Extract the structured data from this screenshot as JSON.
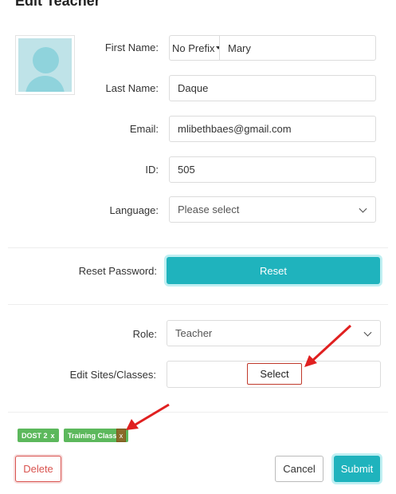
{
  "modal": {
    "title": "Edit Teacher"
  },
  "form": {
    "first_name": {
      "label": "First Name:",
      "prefix": "No Prefix",
      "value": "Mary"
    },
    "last_name": {
      "label": "Last Name:",
      "value": "Daque"
    },
    "email": {
      "label": "Email:",
      "value": "mlibethbaes@gmail.com"
    },
    "id": {
      "label": "ID:",
      "value": "505"
    },
    "language": {
      "label": "Language:",
      "placeholder": "Please select"
    },
    "reset_password": {
      "label": "Reset Password:",
      "button": "Reset"
    },
    "role": {
      "label": "Role:",
      "value": "Teacher"
    },
    "sites": {
      "label": "Edit Sites/Classes:",
      "button": "Select"
    }
  },
  "tags": [
    {
      "label": "DOST 2",
      "remove": "x"
    },
    {
      "label": "Training Class",
      "remove": "x"
    }
  ],
  "footer": {
    "delete": "Delete",
    "cancel": "Cancel",
    "submit": "Submit"
  },
  "colors": {
    "accent": "#1fb3bd",
    "danger": "#d9534f",
    "tag": "#5cb85c",
    "annotation_arrow": "#e02020"
  },
  "icons": {
    "avatar": "user-placeholder-icon",
    "dropdown": "chevron-down-icon",
    "remove": "close-icon"
  }
}
